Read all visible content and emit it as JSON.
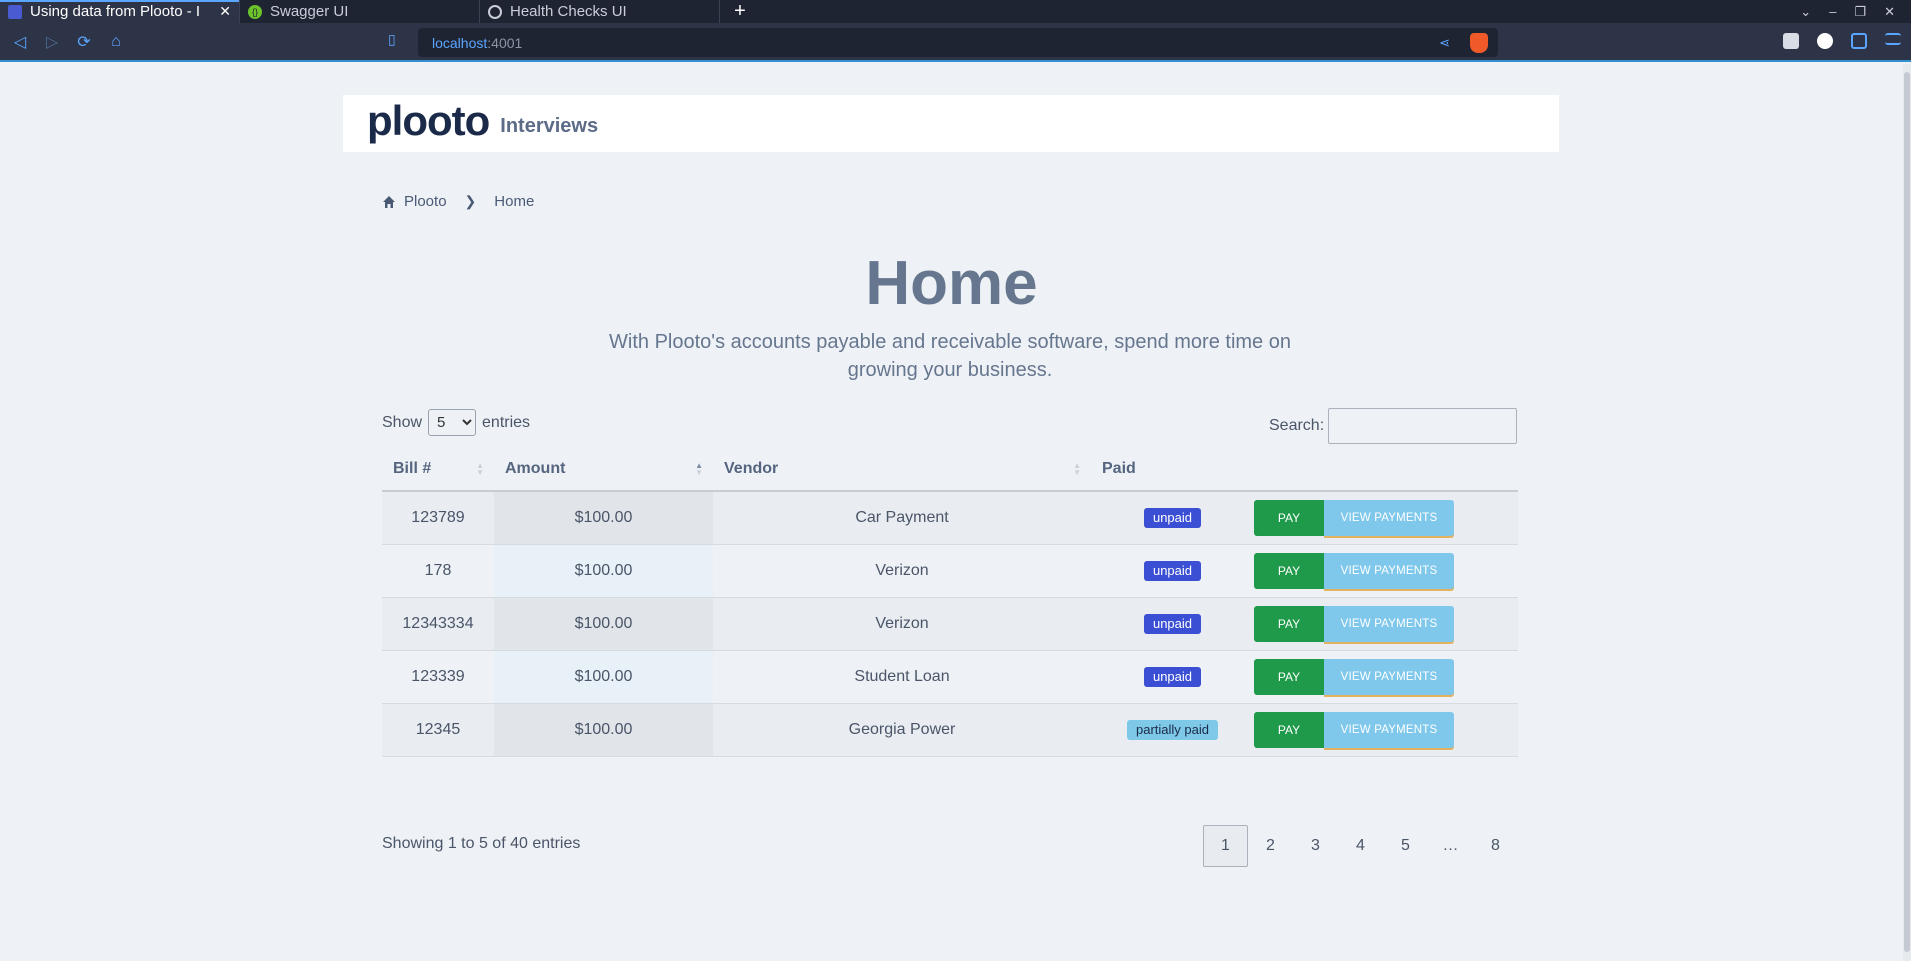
{
  "browser": {
    "tabs": [
      {
        "title": "Using data from Plooto - I",
        "active": true,
        "icon": "plooto-favicon"
      },
      {
        "title": "Swagger UI",
        "active": false,
        "icon": "swagger-favicon"
      },
      {
        "title": "Health Checks UI",
        "active": false,
        "icon": "globe-icon"
      }
    ],
    "url_host": "localhost",
    "url_rest": ":4001"
  },
  "header": {
    "logo": "plooto",
    "subtitle": "Interviews"
  },
  "breadcrumb": {
    "home": "Plooto",
    "current": "Home"
  },
  "hero": {
    "title": "Home",
    "subtitle": "With Plooto's accounts payable and receivable software, spend more time on growing your business."
  },
  "controls": {
    "show_label": "Show",
    "show_value": "5",
    "entries_label": "entries",
    "search_label": "Search:",
    "search_value": ""
  },
  "table": {
    "columns": [
      "Bill #",
      "Amount",
      "Vendor",
      "Paid"
    ],
    "pay_label": "PAY",
    "view_label": "VIEW PAYMENTS",
    "rows": [
      {
        "bill": "123789",
        "amount": "$100.00",
        "vendor": "Car Payment",
        "paid": "unpaid"
      },
      {
        "bill": "178",
        "amount": "$100.00",
        "vendor": "Verizon",
        "paid": "unpaid"
      },
      {
        "bill": "12343334",
        "amount": "$100.00",
        "vendor": "Verizon",
        "paid": "unpaid"
      },
      {
        "bill": "123339",
        "amount": "$100.00",
        "vendor": "Student Loan",
        "paid": "unpaid"
      },
      {
        "bill": "12345",
        "amount": "$100.00",
        "vendor": "Georgia Power",
        "paid": "partially paid"
      }
    ]
  },
  "footer": {
    "info": "Showing 1 to 5 of 40 entries",
    "pages": [
      "1",
      "2",
      "3",
      "4",
      "5",
      "…",
      "8"
    ],
    "current_page": "1"
  },
  "colors": {
    "pay": "#1f9a4a",
    "view": "#7fc8ec",
    "unpaid": "#3b4fd4",
    "partial": "#7ec8e8",
    "accent": "#5aa6ff"
  }
}
